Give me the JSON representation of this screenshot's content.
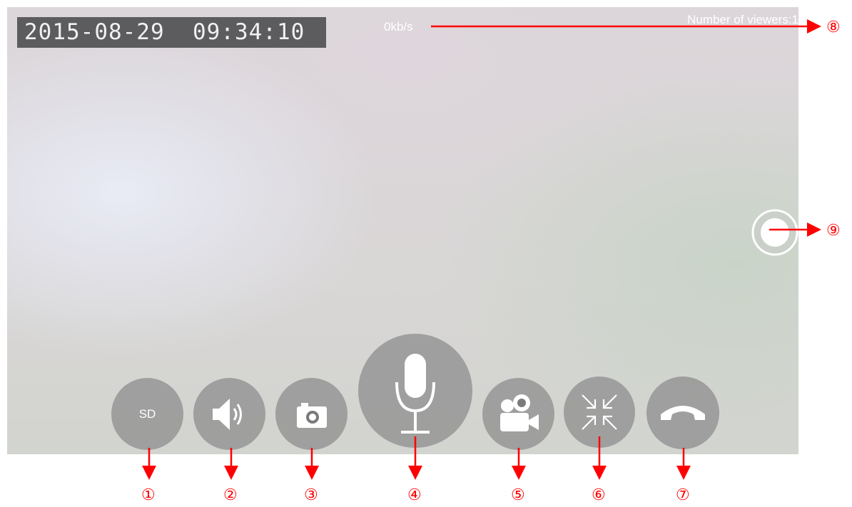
{
  "overlay": {
    "datetime": "2015-08-29  09:34:10",
    "bitrate": "0kb/s",
    "viewers": "Number of viewers:1"
  },
  "controls": {
    "quality_label": "SD",
    "icons": [
      "sd-icon",
      "speaker-icon",
      "camera-icon",
      "microphone-icon",
      "video-record-icon",
      "exit-fullscreen-icon",
      "hang-up-icon",
      "focus-ring-icon"
    ]
  },
  "annotations": {
    "markers": [
      "①",
      "②",
      "③",
      "④",
      "⑤",
      "⑥",
      "⑦",
      "⑧",
      "⑨"
    ],
    "color": "#ff0000"
  }
}
